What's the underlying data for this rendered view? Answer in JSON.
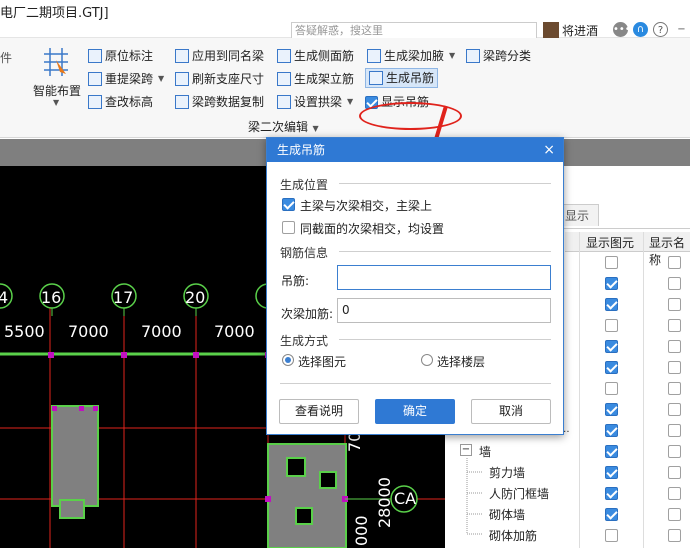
{
  "window": {
    "title": "电厂二期项目.GTJ]",
    "search_placeholder": "答疑解惑，搜这里",
    "username": "将进酒",
    "left_tab_fragment": "件"
  },
  "ribbon": {
    "smart_layout": "智能布置",
    "items_col1": [
      "原位标注",
      "重提梁跨",
      "查改标高"
    ],
    "items_col2": [
      "应用到同名梁",
      "刷新支座尺寸",
      "梁跨数据复制"
    ],
    "items_col3": [
      "生成侧面筋",
      "生成架立筋",
      "设置拱梁"
    ],
    "items_col4": [
      "生成梁加腋",
      "生成吊筋",
      "显示吊筋"
    ],
    "items_col5": [
      "梁跨分类"
    ],
    "group_label": "梁二次编辑",
    "show_hanger_checked": true
  },
  "canvas": {
    "axis_numbers": [
      "4",
      "16",
      "17",
      "20"
    ],
    "spans": [
      "5500",
      "7000",
      "7000",
      "7000"
    ],
    "vertical_dims": [
      "7000",
      "28000"
    ],
    "axis_label_right": "CA",
    "bottom_zero": "000"
  },
  "panel": {
    "tab_label": "显示",
    "col_headers": [
      "显示图元",
      "显示名称"
    ],
    "row_checks": [
      false,
      true,
      true,
      false,
      true,
      true,
      false,
      true,
      true,
      true,
      true
    ],
    "tree": [
      {
        "label": "墙",
        "indent": 0,
        "expander": "−",
        "checked": true
      },
      {
        "label": "剪力墙",
        "indent": 1,
        "checked": true
      },
      {
        "label": "人防门框墙",
        "indent": 1,
        "checked": true
      },
      {
        "label": "砌体墙",
        "indent": 1,
        "checked": true
      },
      {
        "label": "砌体加筋",
        "indent": 1,
        "checked": false
      }
    ],
    "ellipsis": "..."
  },
  "dialog": {
    "title": "生成吊筋",
    "close": "×",
    "section_position": "生成位置",
    "opt_main_secondary": "主梁与次梁相交，主梁上",
    "opt_main_secondary_checked": true,
    "opt_same_section": "同截面的次梁相交，均设置",
    "opt_same_section_checked": false,
    "section_rebar": "钢筋信息",
    "hanger_label": "吊筋:",
    "hanger_value": "",
    "stirrup_label": "次梁加筋:",
    "stirrup_value": "0",
    "section_method": "生成方式",
    "method_select_element": "选择图元",
    "method_select_floor": "选择楼层",
    "selected_method": "选择图元",
    "btn_help": "查看说明",
    "btn_ok": "确定",
    "btn_cancel": "取消"
  },
  "colors": {
    "accent": "#2f79d4",
    "callout": "#e0231c",
    "canvas_bg": "#000000",
    "grid_red": "#e0231c",
    "beam_green": "#5ad04a",
    "column_gray": "#808080",
    "node_magenta": "#c010c0"
  }
}
